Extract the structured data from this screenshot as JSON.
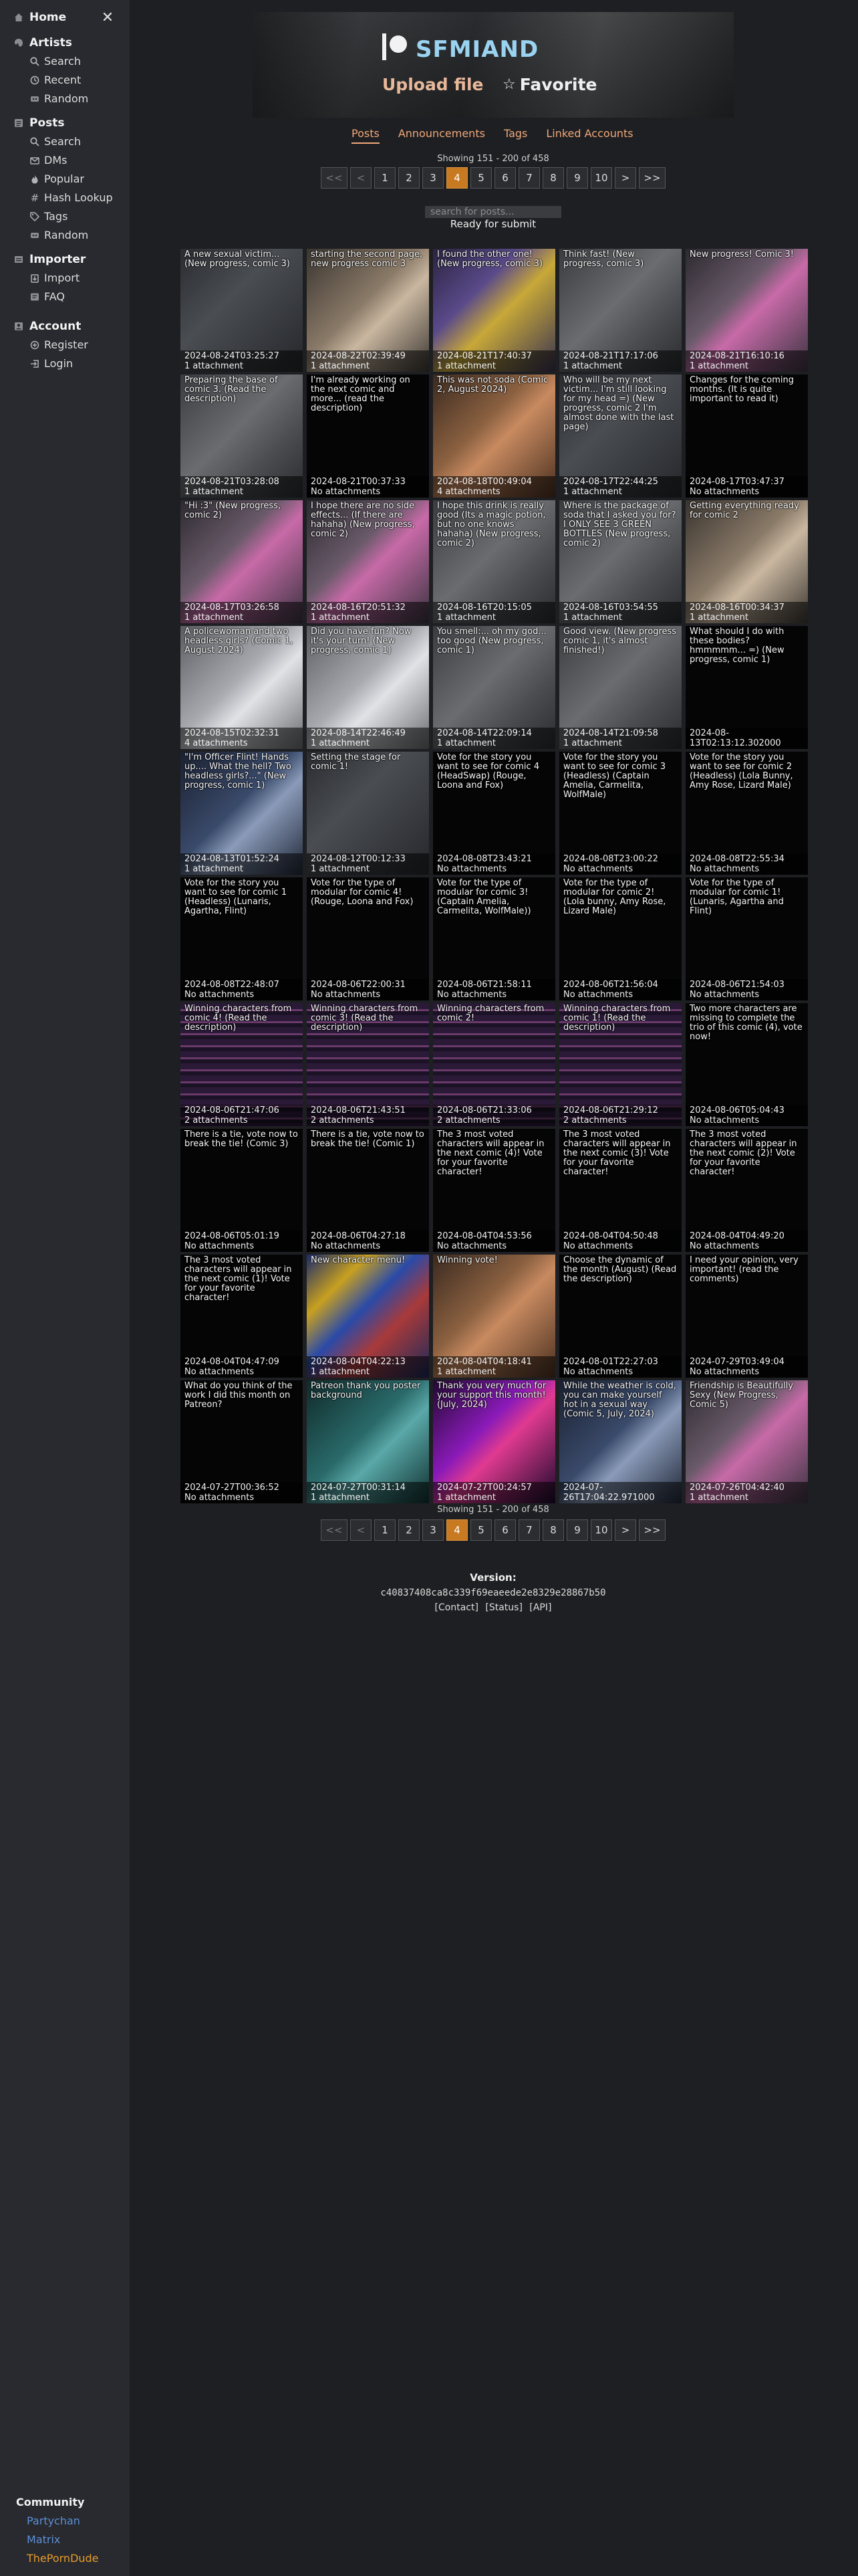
{
  "sidebar": {
    "home": "Home",
    "artists": {
      "title": "Artists",
      "items": [
        "Search",
        "Recent",
        "Random"
      ]
    },
    "posts": {
      "title": "Posts",
      "items": [
        "Search",
        "DMs",
        "Popular",
        "Hash Lookup",
        "Tags",
        "Random"
      ]
    },
    "importer": {
      "title": "Importer",
      "items": [
        "Import",
        "FAQ"
      ]
    },
    "account": {
      "title": "Account",
      "items": [
        "Register",
        "Login"
      ]
    },
    "community": {
      "title": "Community",
      "links": [
        {
          "label": "Partychan",
          "color": "#5b8fd6"
        },
        {
          "label": "Matrix",
          "color": "#5b8fd6"
        },
        {
          "label": "ThePornDude",
          "color": "#e89a2a"
        }
      ]
    }
  },
  "creator": {
    "name": "SFMIAND",
    "upload": "Upload file",
    "favorite": "Favorite",
    "favorite_icon": "star-icon"
  },
  "tabs": [
    "Posts",
    "Announcements",
    "Tags",
    "Linked Accounts"
  ],
  "showing": "Showing 151 - 200 of 458",
  "pagination": [
    "<<",
    "<",
    "1",
    "2",
    "3",
    "4",
    "5",
    "6",
    "7",
    "8",
    "9",
    "10",
    ">",
    ">>"
  ],
  "current_page": "4",
  "search": {
    "placeholder": "search for posts..."
  },
  "status": "Ready for submit",
  "posts": [
    {
      "title": "A new sexual victim... (New progress, comic 3)",
      "date": "2024-08-24T03:25:27",
      "attachments": "1 attachment",
      "thumb": "dark"
    },
    {
      "title": "starting the second page, new progress comic 3",
      "date": "2024-08-22T02:39:49",
      "attachments": "1 attachment",
      "thumb": "beige"
    },
    {
      "title": "I found the other one! (New progress, comic 3)",
      "date": "2024-08-21T17:40:37",
      "attachments": "1 attachment",
      "thumb": "purple"
    },
    {
      "title": "Think fast! (New progress, comic 3)",
      "date": "2024-08-21T17:17:06",
      "attachments": "1 attachment",
      "thumb": "gray"
    },
    {
      "title": "New progress! Comic 3!",
      "date": "2024-08-21T16:10:16",
      "attachments": "1 attachment",
      "thumb": "pink"
    },
    {
      "title": "Preparing the base of comic 3. (Read the description)",
      "date": "2024-08-21T03:28:08",
      "attachments": "1 attachment",
      "thumb": "gray"
    },
    {
      "title": "I'm already working on the next comic and more... (read the description)",
      "date": "2024-08-21T00:37:33",
      "attachments": "No attachments",
      "thumb": "none"
    },
    {
      "title": "This was not soda (Comic 2, August 2024)",
      "date": "2024-08-18T00:49:04",
      "attachments": "4 attachments",
      "thumb": "warm"
    },
    {
      "title": "Who will be my next victim... I'm still looking for my head =) (New progress, comic 2 I'm almost done with the last page)",
      "date": "2024-08-17T22:44:25",
      "attachments": "1 attachment",
      "thumb": "dark"
    },
    {
      "title": "Changes for the coming months. (It is quite important to read it)",
      "date": "2024-08-17T03:47:37",
      "attachments": "No attachments",
      "thumb": "none"
    },
    {
      "title": "\"Hi :3\" (New progress, comic 2)",
      "date": "2024-08-17T03:26:58",
      "attachments": "1 attachment",
      "thumb": "pink"
    },
    {
      "title": "I hope there are no side effects... (If there are hahaha) (New progress, comic 2)",
      "date": "2024-08-16T20:51:32",
      "attachments": "1 attachment",
      "thumb": "pink"
    },
    {
      "title": "I hope this drink is really good (Its a magic potion, but no one knows hahaha) (New progress, comic 2)",
      "date": "2024-08-16T20:15:05",
      "attachments": "1 attachment",
      "thumb": "gray"
    },
    {
      "title": "Where is the package of soda that I asked you for? I ONLY SEE 3 GREEN BOTTLES (New progress, comic 2)",
      "date": "2024-08-16T03:54:55",
      "attachments": "1 attachment",
      "thumb": "gray"
    },
    {
      "title": "Getting everything ready for comic 2",
      "date": "2024-08-16T00:34:37",
      "attachments": "1 attachment",
      "thumb": "beige"
    },
    {
      "title": "A policewoman and two headless girls? (Comic 1, August 2024)",
      "date": "2024-08-15T02:32:31",
      "attachments": "4 attachments",
      "thumb": "light"
    },
    {
      "title": "Did you have fun? Now it's your turn! (New progress, comic 1)",
      "date": "2024-08-14T22:46:49",
      "attachments": "1 attachment",
      "thumb": "light"
    },
    {
      "title": "You smell:... oh my god... too good (New progress, comic 1)",
      "date": "2024-08-14T22:09:14",
      "attachments": "1 attachment",
      "thumb": "gray"
    },
    {
      "title": "Good view. (New progress comic 1, it's almost finished!)",
      "date": "2024-08-14T21:09:58",
      "attachments": "1 attachment",
      "thumb": "gray"
    },
    {
      "title": "What should I do with these bodies? hmmmmm... =) (New progress, comic 1)",
      "date": "2024-08-13T02:13:12.302000",
      "attachments": "1 attachment",
      "thumb": "none"
    },
    {
      "title": "\"I'm Officer Flint! Hands up.... What the hell? Two headless girls?...\" (New progress, comic 1)",
      "date": "2024-08-13T01:52:24",
      "attachments": "1 attachment",
      "thumb": "blue"
    },
    {
      "title": "Setting the stage for comic 1!",
      "date": "2024-08-12T00:12:33",
      "attachments": "1 attachment",
      "thumb": "dark"
    },
    {
      "title": "Vote for the story you want to see for comic 4 (HeadSwap) (Rouge, Loona and Fox)",
      "date": "2024-08-08T23:43:21",
      "attachments": "No attachments",
      "thumb": "none"
    },
    {
      "title": "Vote for the story you want to see for comic 3 (Headless) (Captain Amelia, Carmelita, WolfMale)",
      "date": "2024-08-08T23:00:22",
      "attachments": "No attachments",
      "thumb": "none"
    },
    {
      "title": "Vote for the story you want to see for comic 2 (Headless) (Lola Bunny, Amy Rose, Lizard Male)",
      "date": "2024-08-08T22:55:34",
      "attachments": "No attachments",
      "thumb": "none"
    },
    {
      "title": "Vote for the story you want to see for comic 1 (Headless) (Lunaris, Agartha, Flint)",
      "date": "2024-08-08T22:48:07",
      "attachments": "No attachments",
      "thumb": "none"
    },
    {
      "title": "Vote for the type of modular for comic 4! (Rouge, Loona and Fox)",
      "date": "2024-08-06T22:00:31",
      "attachments": "No attachments",
      "thumb": "none"
    },
    {
      "title": "Vote for the type of modular for comic 3! (Captain Amelia, Carmelita, WolfMale))",
      "date": "2024-08-06T21:58:11",
      "attachments": "No attachments",
      "thumb": "none"
    },
    {
      "title": "Vote for the type of modular for comic 2! (Lola bunny, Amy Rose, Lizard Male)",
      "date": "2024-08-06T21:56:04",
      "attachments": "No attachments",
      "thumb": "none"
    },
    {
      "title": "Vote for the type of modular for comic 1! (Lunaris, Agartha and Flint)",
      "date": "2024-08-06T21:54:03",
      "attachments": "No attachments",
      "thumb": "none"
    },
    {
      "title": "Winning characters from comic 4! (Read the description)",
      "date": "2024-08-06T21:47:06",
      "attachments": "2 attachments",
      "thumb": "list"
    },
    {
      "title": "Winning characters from comic 3! (Read the description)",
      "date": "2024-08-06T21:43:51",
      "attachments": "2 attachments",
      "thumb": "list"
    },
    {
      "title": "Winning characters from comic 2!",
      "date": "2024-08-06T21:33:06",
      "attachments": "2 attachments",
      "thumb": "list"
    },
    {
      "title": "Winning characters from comic 1! (Read the description)",
      "date": "2024-08-06T21:29:12",
      "attachments": "2 attachments",
      "thumb": "list"
    },
    {
      "title": "Two more characters are missing to complete the trio of this comic (4), vote now!",
      "date": "2024-08-06T05:04:43",
      "attachments": "No attachments",
      "thumb": "none"
    },
    {
      "title": "There is a tie, vote now to break the tie! (Comic 3)",
      "date": "2024-08-06T05:01:19",
      "attachments": "No attachments",
      "thumb": "none"
    },
    {
      "title": "There is a tie, vote now to break the tie! (Comic 1)",
      "date": "2024-08-06T04:27:18",
      "attachments": "No attachments",
      "thumb": "none"
    },
    {
      "title": "The 3 most voted characters will appear in the next comic (4)! Vote for your favorite character!",
      "date": "2024-08-04T04:53:56",
      "attachments": "No attachments",
      "thumb": "none"
    },
    {
      "title": "The 3 most voted characters will appear in the next comic (3)! Vote for your favorite character!",
      "date": "2024-08-04T04:50:48",
      "attachments": "No attachments",
      "thumb": "none"
    },
    {
      "title": "The 3 most voted characters will appear in the next comic (2)! Vote for your favorite character!",
      "date": "2024-08-04T04:49:20",
      "attachments": "No attachments",
      "thumb": "none"
    },
    {
      "title": "The 3 most voted characters will appear in the next comic (1)! Vote for your favorite character!",
      "date": "2024-08-04T04:47:09",
      "attachments": "No attachments",
      "thumb": "none"
    },
    {
      "title": "New character menu!",
      "date": "2024-08-04T04:22:13",
      "attachments": "1 attachment",
      "thumb": "menu"
    },
    {
      "title": "Winning vote!",
      "date": "2024-08-04T04:18:41",
      "attachments": "1 attachment",
      "thumb": "warm"
    },
    {
      "title": "Choose the dynamic of the month (August) (Read the description)",
      "date": "2024-08-01T22:27:03",
      "attachments": "No attachments",
      "thumb": "none"
    },
    {
      "title": "I need your opinion, very important! (read the comments)",
      "date": "2024-07-29T03:49:04",
      "attachments": "No attachments",
      "thumb": "none"
    },
    {
      "title": "What do you think of the work I did this month on Patreon?",
      "date": "2024-07-27T00:36:52",
      "attachments": "No attachments",
      "thumb": "none"
    },
    {
      "title": "Patreon thank you poster background",
      "date": "2024-07-27T00:31:14",
      "attachments": "1 attachment",
      "thumb": "teal"
    },
    {
      "title": "Thank you very much for your support this month! (July, 2024)",
      "date": "2024-07-27T00:24:57",
      "attachments": "1 attachment",
      "thumb": "magenta"
    },
    {
      "title": "While the weather is cold, you can make yourself hot in a sexual way (Comic 5, July, 2024)",
      "date": "2024-07-26T17:04:22.971000",
      "attachments": "2 attachments",
      "thumb": "blue"
    },
    {
      "title": "Friendship is Beautifully Sexy (New Progress, Comic 5)",
      "date": "2024-07-26T04:42:40",
      "attachments": "1 attachment",
      "thumb": "pink"
    }
  ],
  "thumb_styles": {
    "dark": "linear-gradient(135deg,#2a2c30 0%,#4a4d52 40%,#25272b 100%)",
    "beige": "linear-gradient(135deg,#3a3530 0%,#8a7a68 45%,#c9b7a0 60%,#3d3833 100%)",
    "purple": "linear-gradient(135deg,#2a2440 0%,#5a4a8a 35%,#c8a838 55%,#3a3450 100%)",
    "gray": "linear-gradient(135deg,#3a3c40 0%,#6a6c70 45%,#4a4c50 70%,#2a2c30 100%)",
    "pink": "linear-gradient(135deg,#2c2a30 0%,#6a5a6a 40%,#c86aa8 55%,#3a3440 100%)",
    "warm": "linear-gradient(135deg,#3a2a20 0%,#8a6040 40%,#c88a60 55%,#4a3020 100%)",
    "light": "linear-gradient(135deg,#5a5c60 0%,#a8aab0 45%,#e0e2e6 60%,#6a6c70 100%)",
    "blue": "linear-gradient(135deg,#1a2030 0%,#3a4a6a 45%,#8a9ab8 60%,#202838 100%)",
    "list": "repeating-linear-gradient(180deg,#2a1a38 0px,#2a1a38 9px,#6a3a6a 9px,#6a3a6a 12px,#1c1226 12px,#1c1226 18px)",
    "menu": "linear-gradient(135deg,#1a2a6a 0%,#c8a020 25%,#2a4aa8 45%,#a83a3a 65%,#1a2a5a 100%)",
    "teal": "linear-gradient(135deg,#102a2a 0%,#2a6a6a 45%,#5aa8a8 60%,#103030 100%)",
    "magenta": "linear-gradient(135deg,#200a30 0%,#8a1ab8 40%,#e03a90 55%,#1a0a2a 100%)",
    "none": "#050505"
  },
  "version": {
    "title": "Version:",
    "hash": "c40837408ca8c339f69eaeede2e8329e28867b50"
  },
  "footer_links": [
    "[Contact]",
    "[Status]",
    "[API]"
  ]
}
